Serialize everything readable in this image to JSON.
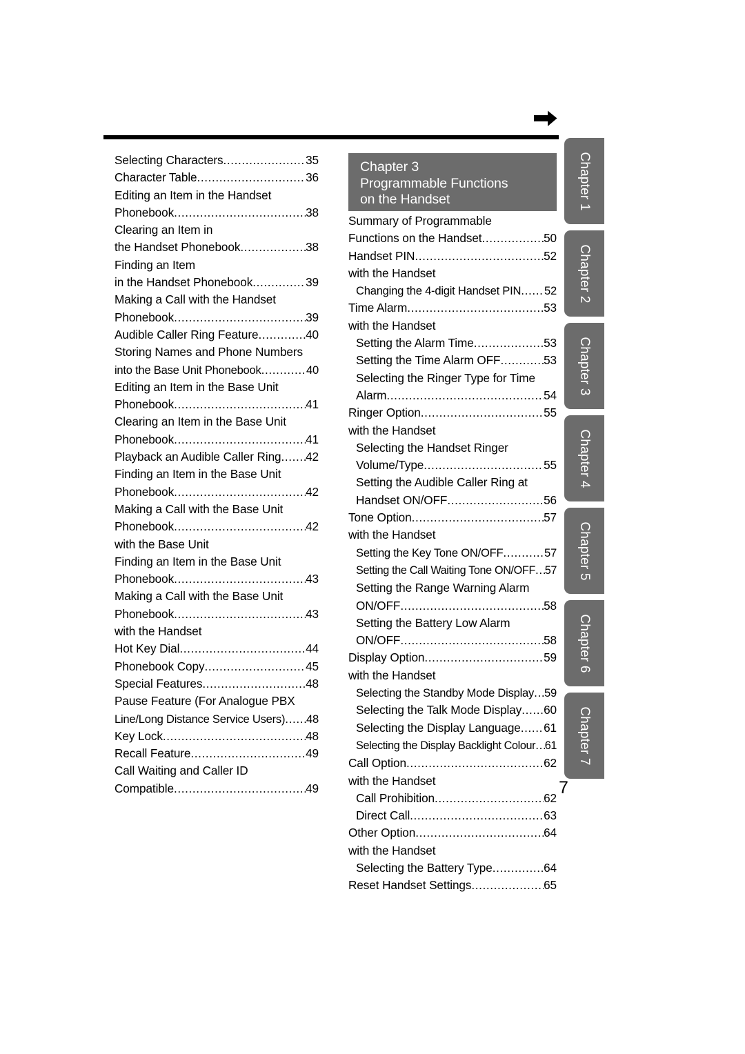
{
  "page": {
    "number": "7",
    "arrow_icon": "right-arrow-icon"
  },
  "chapter_header": {
    "line1": "Chapter 3",
    "line2": "Programmable Functions",
    "line3": "on the Handset",
    "background_color": "#6c6c6c",
    "text_color": "#ffffff"
  },
  "left_column": {
    "entries": [
      {
        "level": 0,
        "label": "Selecting Characters",
        "page": "35",
        "leader": true
      },
      {
        "level": 0,
        "label": "Character Table",
        "page": "36",
        "leader": true
      },
      {
        "level": 0,
        "label": "Editing an Item in the Handset",
        "page": "",
        "leader": false
      },
      {
        "level": 0,
        "label": "Phonebook",
        "page": "38",
        "leader": true
      },
      {
        "level": 0,
        "label": "Clearing an Item in",
        "page": "",
        "leader": false
      },
      {
        "level": 0,
        "label": "the Handset Phonebook",
        "page": "38",
        "leader": true
      },
      {
        "level": 0,
        "label": "Finding an Item",
        "page": "",
        "leader": false
      },
      {
        "level": 0,
        "label": "in the Handset Phonebook",
        "page": "39",
        "leader": true
      },
      {
        "level": 0,
        "label": "Making a Call with the Handset",
        "page": "",
        "leader": false
      },
      {
        "level": 0,
        "label": "Phonebook",
        "page": "39",
        "leader": true
      },
      {
        "level": 0,
        "label": "Audible Caller Ring Feature",
        "page": "40",
        "leader": true
      },
      {
        "level": 0,
        "label": "Storing Names and Phone Numbers",
        "page": "",
        "leader": false
      },
      {
        "level": 0,
        "label": "into the Base Unit Phonebook",
        "page": "40",
        "leader": true
      },
      {
        "level": 0,
        "label": "Editing an Item in the Base Unit",
        "page": "",
        "leader": false
      },
      {
        "level": 0,
        "label": "Phonebook",
        "page": "41",
        "leader": true
      },
      {
        "level": 0,
        "label": "Clearing an Item in the Base Unit",
        "page": "",
        "leader": false
      },
      {
        "level": 0,
        "label": "Phonebook",
        "page": "41",
        "leader": true
      },
      {
        "level": 0,
        "label": "Playback an Audible Caller Ring",
        "page": "42",
        "leader": true
      },
      {
        "level": 0,
        "label": "Finding an Item in the Base Unit",
        "page": "",
        "leader": false
      },
      {
        "level": 0,
        "label": "Phonebook",
        "page": "42",
        "leader": true
      },
      {
        "level": 0,
        "label": "Making a Call with the Base Unit",
        "page": "",
        "leader": false
      },
      {
        "level": 0,
        "label": "Phonebook",
        "page": "42",
        "leader": true
      },
      {
        "level": "sub",
        "label": "with the Base Unit",
        "page": "",
        "leader": false
      },
      {
        "level": 0,
        "label": "Finding an Item in the Base Unit",
        "page": "",
        "leader": false
      },
      {
        "level": 0,
        "label": "Phonebook",
        "page": "43",
        "leader": true
      },
      {
        "level": 0,
        "label": "Making a Call with the Base Unit",
        "page": "",
        "leader": false
      },
      {
        "level": 0,
        "label": "Phonebook",
        "page": "43",
        "leader": true
      },
      {
        "level": "sub",
        "label": "with the Handset",
        "page": "",
        "leader": false
      },
      {
        "level": 0,
        "label": "Hot Key Dial",
        "page": "44",
        "leader": true
      },
      {
        "level": 0,
        "label": "Phonebook Copy",
        "page": "45",
        "leader": true
      },
      {
        "level": "sub",
        "label": "Special Features",
        "page": "48",
        "leader": true
      },
      {
        "level": 0,
        "label": "Pause Feature (For Analogue PBX",
        "page": "",
        "leader": false
      },
      {
        "level": 0,
        "label": "Line/Long Distance Service Users)",
        "page": "48",
        "leader": true
      },
      {
        "level": 0,
        "label": "Key Lock",
        "page": "48",
        "leader": true
      },
      {
        "level": 0,
        "label": "Recall Feature",
        "page": "49",
        "leader": true
      },
      {
        "level": 0,
        "label": "Call Waiting and Caller ID",
        "page": "",
        "leader": false
      },
      {
        "level": 0,
        "label": "Compatible",
        "page": "49",
        "leader": true
      }
    ]
  },
  "right_column": {
    "entries": [
      {
        "level": 0,
        "label": "Summary of Programmable",
        "page": "",
        "leader": false
      },
      {
        "level": 0,
        "label": "Functions on the Handset",
        "page": "50",
        "leader": true
      },
      {
        "level": 0,
        "label": "Handset PIN",
        "page": "52",
        "leader": true
      },
      {
        "level": 0,
        "label": "with the Handset",
        "page": "",
        "leader": false
      },
      {
        "level": 1,
        "label": "Changing the 4-digit Handset PIN",
        "page": "52",
        "leader": true
      },
      {
        "level": 0,
        "label": "Time Alarm",
        "page": "53",
        "leader": true
      },
      {
        "level": 0,
        "label": "with the Handset",
        "page": "",
        "leader": false
      },
      {
        "level": 1,
        "label": "Setting the Alarm Time",
        "page": "53",
        "leader": true
      },
      {
        "level": 1,
        "label": "Setting the Time Alarm OFF",
        "page": "53",
        "leader": true
      },
      {
        "level": 1,
        "label": "Selecting the Ringer Type for Time",
        "page": "",
        "leader": false
      },
      {
        "level": 1,
        "label": "Alarm",
        "page": "54",
        "leader": true
      },
      {
        "level": 0,
        "label": "Ringer Option",
        "page": "55",
        "leader": true
      },
      {
        "level": 0,
        "label": "with the Handset",
        "page": "",
        "leader": false
      },
      {
        "level": 1,
        "label": "Selecting the Handset Ringer",
        "page": "",
        "leader": false
      },
      {
        "level": 1,
        "label": "Volume/Type",
        "page": "55",
        "leader": true
      },
      {
        "level": 1,
        "label": "Setting the Audible Caller Ring at",
        "page": "",
        "leader": false
      },
      {
        "level": 1,
        "label": "Handset ON/OFF",
        "page": "56",
        "leader": true
      },
      {
        "level": 0,
        "label": "Tone Option",
        "page": "57",
        "leader": true
      },
      {
        "level": 0,
        "label": "with the Handset",
        "page": "",
        "leader": false
      },
      {
        "level": 1,
        "label": "Setting the Key Tone ON/OFF",
        "page": "57",
        "leader": true
      },
      {
        "level": 1,
        "label": "Setting the Call Waiting Tone ON/OFF",
        "page": "57",
        "leader": true
      },
      {
        "level": 1,
        "label": "Setting the Range Warning Alarm",
        "page": "",
        "leader": false
      },
      {
        "level": 1,
        "label": "ON/OFF",
        "page": "58",
        "leader": true
      },
      {
        "level": 1,
        "label": "Setting the Battery Low Alarm",
        "page": "",
        "leader": false
      },
      {
        "level": 1,
        "label": "ON/OFF",
        "page": "58",
        "leader": true
      },
      {
        "level": 0,
        "label": "Display Option",
        "page": "59",
        "leader": true
      },
      {
        "level": 0,
        "label": "with the Handset",
        "page": "",
        "leader": false
      },
      {
        "level": 1,
        "label": "Selecting the Standby Mode Display",
        "page": "59",
        "leader": true
      },
      {
        "level": 1,
        "label": "Selecting the Talk Mode Display",
        "page": "60",
        "leader": true
      },
      {
        "level": 1,
        "label": "Selecting the Display Language",
        "page": "61",
        "leader": true
      },
      {
        "level": 1,
        "label": "Selecting the Display Backlight Colour",
        "page": "61",
        "leader": true
      },
      {
        "level": 0,
        "label": "Call Option",
        "page": "62",
        "leader": true
      },
      {
        "level": 0,
        "label": "with the Handset",
        "page": "",
        "leader": false
      },
      {
        "level": 1,
        "label": "Call Prohibition",
        "page": "62",
        "leader": true
      },
      {
        "level": 1,
        "label": "Direct Call",
        "page": "63",
        "leader": true
      },
      {
        "level": 0,
        "label": "Other Option",
        "page": "64",
        "leader": true
      },
      {
        "level": 0,
        "label": "with the Handset",
        "page": "",
        "leader": false
      },
      {
        "level": 1,
        "label": "Selecting the Battery Type",
        "page": "64",
        "leader": true
      },
      {
        "level": 0,
        "label": "Reset Handset Settings",
        "page": "65",
        "leader": true
      }
    ]
  },
  "chapter_tabs": {
    "background_color": "#6c6c6c",
    "items": [
      {
        "label": "Chapter 1"
      },
      {
        "label": "Chapter 2"
      },
      {
        "label": "Chapter 3"
      },
      {
        "label": "Chapter 4"
      },
      {
        "label": "Chapter 5"
      },
      {
        "label": "Chapter 6"
      },
      {
        "label": "Chapter 7"
      }
    ]
  }
}
